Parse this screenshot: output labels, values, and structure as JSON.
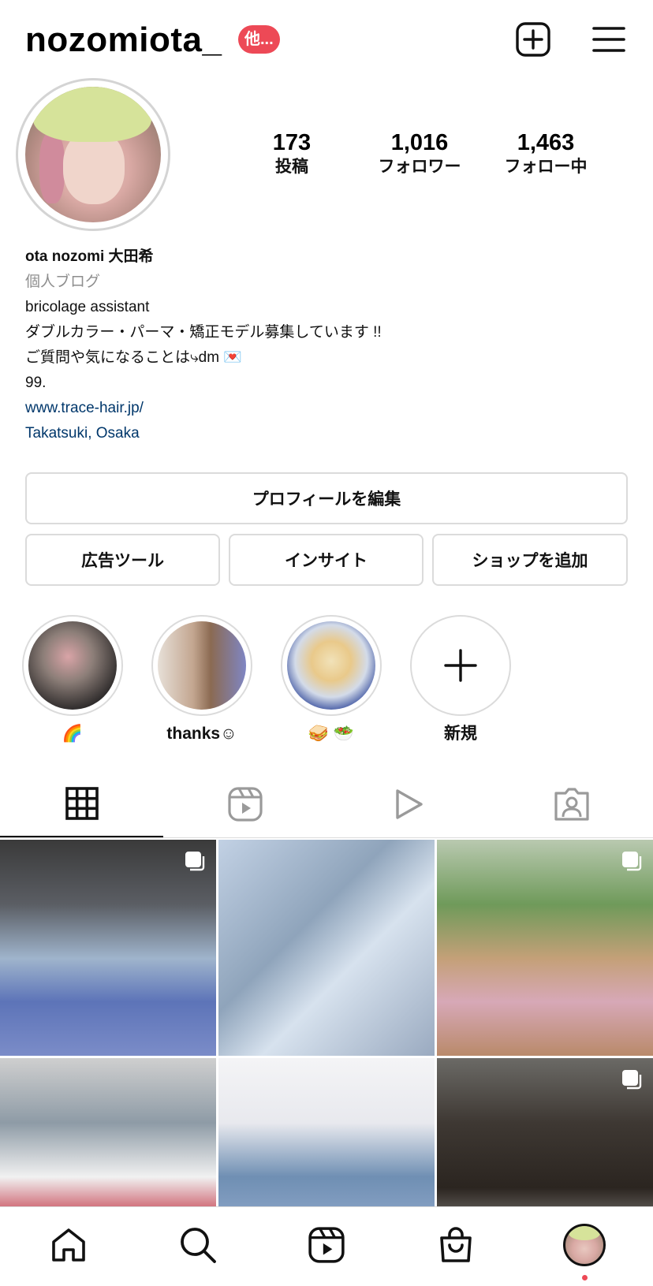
{
  "header": {
    "username": "nozomiota_",
    "notification_badge": "他..."
  },
  "profile": {
    "stats": {
      "posts_count": "173",
      "posts_label": "投稿",
      "followers_count": "1,016",
      "followers_label": "フォロワー",
      "following_count": "1,463",
      "following_label": "フォロー中"
    },
    "bio": {
      "name": "ota nozomi 大田希",
      "category": "個人ブログ",
      "line1": "bricolage assistant",
      "line2": "ダブルカラー・パーマ・矯正モデル募集しています !!",
      "line3": "ご質問や気になることは⤷dm 💌",
      "line4": "99.",
      "website": "www.trace-hair.jp/",
      "location": "Takatsuki, Osaka"
    }
  },
  "buttons": {
    "edit_profile": "プロフィールを編集",
    "ad_tools": "広告ツール",
    "insights": "インサイト",
    "add_shop": "ショップを追加"
  },
  "highlights": [
    {
      "label": "🌈"
    },
    {
      "label": "thanks☺︎"
    },
    {
      "label": "🥪 🥗"
    },
    {
      "label": "新規"
    }
  ],
  "tabs": {
    "active": "grid",
    "items": [
      "grid-icon",
      "reels-icon",
      "video-icon",
      "tagged-icon"
    ]
  },
  "colors": {
    "accent_red": "#ed4956",
    "link_blue": "#00376b",
    "border": "#dbdbdb",
    "secondary_text": "#8e8e8e"
  },
  "bottom_nav": {
    "items": [
      "home-icon",
      "search-icon",
      "reels-icon",
      "shop-icon",
      "profile-avatar"
    ],
    "active": "profile"
  }
}
